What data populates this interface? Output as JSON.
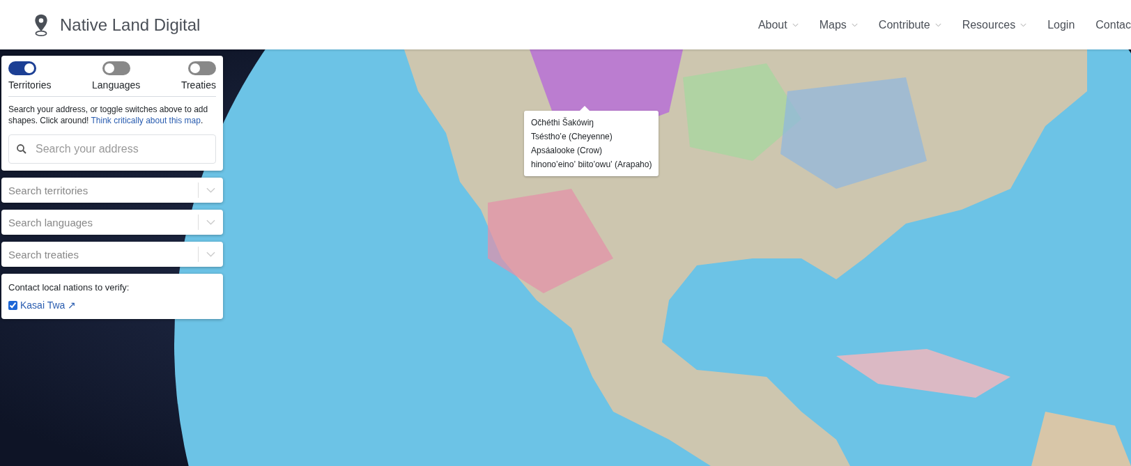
{
  "header": {
    "logo_text": "Native Land Digital",
    "nav": [
      {
        "label": "About",
        "dropdown": true
      },
      {
        "label": "Maps",
        "dropdown": true
      },
      {
        "label": "Contribute",
        "dropdown": true
      },
      {
        "label": "Resources",
        "dropdown": true
      },
      {
        "label": "Login",
        "dropdown": false
      },
      {
        "label": "Contac",
        "dropdown": false
      }
    ]
  },
  "layers_panel": {
    "toggles": [
      {
        "label": "Territories",
        "on": true
      },
      {
        "label": "Languages",
        "on": false
      },
      {
        "label": "Treaties",
        "on": false
      }
    ],
    "description": "Search your address, or toggle switches above to add shapes. Click around!",
    "description_link": "Think critically about this map",
    "description_end": ".",
    "address_search": {
      "placeholder": "Search your address"
    }
  },
  "selects": [
    {
      "placeholder": "Search territories"
    },
    {
      "placeholder": "Search languages"
    },
    {
      "placeholder": "Search treaties"
    }
  ],
  "verify_panel": {
    "title": "Contact local nations to verify:",
    "items": [
      {
        "label": "Kasai Twa",
        "mark": "↗",
        "checked": true
      }
    ]
  },
  "tooltip": {
    "lines": [
      "Očhéthi Šakówiŋ",
      "Tsésthoʼe (Cheyenne)",
      "Apsáalooke (Crow)",
      "hinonoʼeinoʼ biitoʼowuʼ (Arapaho)"
    ]
  }
}
